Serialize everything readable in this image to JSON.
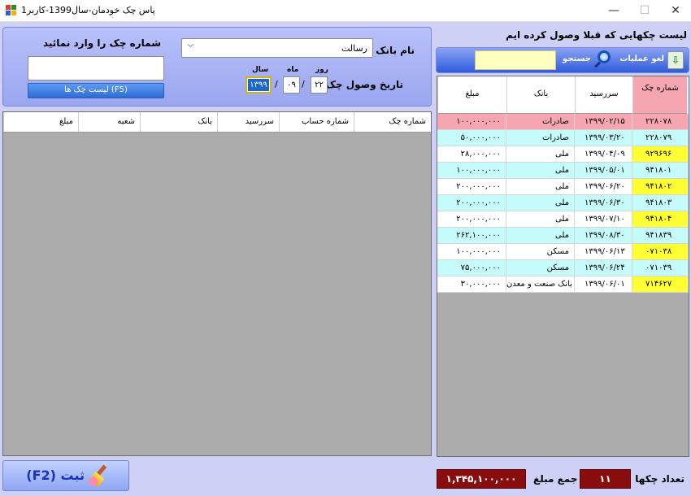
{
  "window": {
    "title": "پاس چک خودمان-سال1399-کاربر1",
    "minimize": "—",
    "maximize": "☐",
    "close": "✕"
  },
  "entry": {
    "check_number_label": "شماره چک را وارد نمائید",
    "check_number_value": "",
    "check_list_button": "لیست چک ها  (F5)",
    "bank_label": "نام بانک",
    "bank_value": "رسالت",
    "date_label": "تاریخ وصول چک",
    "day_label": "روز",
    "month_label": "ماه",
    "year_label": "سال",
    "day_value": "۲۲",
    "month_value": "۰۹",
    "year_value": "۱۳۹۹",
    "date_sep": "/"
  },
  "left_table": {
    "columns": [
      "شماره چک",
      "شماره حساب",
      "سررسید",
      "بانک",
      "شعبه",
      "مبلغ"
    ]
  },
  "right_panel": {
    "title": "لیست چکهایی که قبلا وصول کرده ایم",
    "cancel_label": "لغو عملیات",
    "search_label": "جستجو",
    "search_value": ""
  },
  "right_table": {
    "columns": {
      "number": "شماره چک",
      "due": "سررسید",
      "bank": "بانک",
      "amount": "مبلغ"
    },
    "rows": [
      {
        "number": "۲۲۸۰۷۸",
        "due": "۱۳۹۹/۰۲/۱۵",
        "bank": "صادرات",
        "amount": "۱۰۰,۰۰۰,۰۰۰"
      },
      {
        "number": "۲۲۸۰۷۹",
        "due": "۱۳۹۹/۰۳/۲۰",
        "bank": "صادرات",
        "amount": "۵۰,۰۰۰,۰۰۰"
      },
      {
        "number": "۹۲۹۶۹۶",
        "due": "۱۳۹۹/۰۴/۰۹",
        "bank": "ملی",
        "amount": "۲۸,۰۰۰,۰۰۰"
      },
      {
        "number": "۹۴۱۸۰۱",
        "due": "۱۳۹۹/۰۵/۰۱",
        "bank": "ملی",
        "amount": "۱۰۰,۰۰۰,۰۰۰"
      },
      {
        "number": "۹۴۱۸۰۲",
        "due": "۱۳۹۹/۰۶/۲۰",
        "bank": "ملی",
        "amount": "۲۰۰,۰۰۰,۰۰۰"
      },
      {
        "number": "۹۴۱۸۰۳",
        "due": "۱۳۹۹/۰۶/۳۰",
        "bank": "ملی",
        "amount": "۲۰۰,۰۰۰,۰۰۰"
      },
      {
        "number": "۹۴۱۸۰۴",
        "due": "۱۳۹۹/۰۷/۱۰",
        "bank": "ملی",
        "amount": "۲۰۰,۰۰۰,۰۰۰"
      },
      {
        "number": "۹۴۱۸۳۹",
        "due": "۱۳۹۹/۰۸/۳۰",
        "bank": "ملی",
        "amount": "۲۶۲,۱۰۰,۰۰۰"
      },
      {
        "number": "۰۷۱۰۳۸",
        "due": "۱۳۹۹/۰۶/۱۳",
        "bank": "مسکن",
        "amount": "۱۰۰,۰۰۰,۰۰۰"
      },
      {
        "number": "۰۷۱۰۳۹",
        "due": "۱۳۹۹/۰۶/۲۴",
        "bank": "مسکن",
        "amount": "۷۵,۰۰۰,۰۰۰"
      },
      {
        "number": "۷۱۴۶۲۷",
        "due": "۱۳۹۹/۰۶/۰۱",
        "bank": "بانک صنعت و معدن",
        "amount": "۳۰,۰۰۰,۰۰۰"
      }
    ]
  },
  "footer": {
    "save_label": "ثبت  (F2)",
    "count_label": "تعداد چکها",
    "count_value": "۱۱",
    "sum_label": "جمع مبلغ",
    "sum_value": "۱,۳۴۵,۱۰۰,۰۰۰"
  },
  "colors": {
    "selected_row": "#f6a6b0",
    "highlight_number": "#ffff33",
    "alt_row": "#c6fbfb",
    "sum_box": "#8a0d0d"
  }
}
